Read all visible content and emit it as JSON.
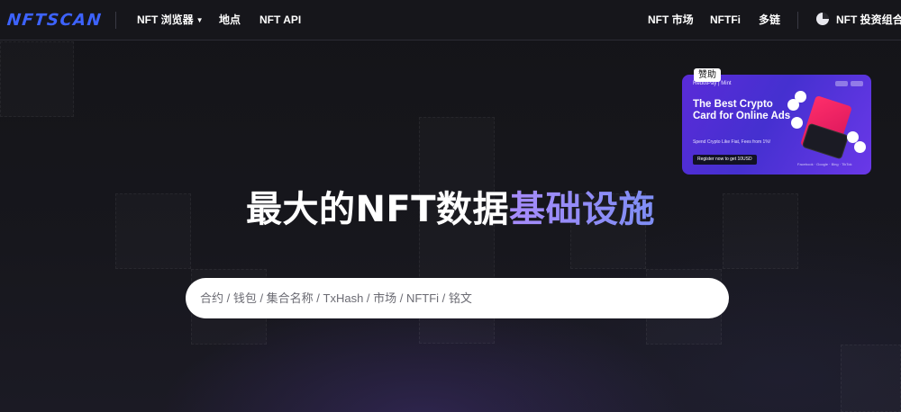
{
  "brand": {
    "logo_text": "NFTSCAN",
    "accent": "#3d63ff"
  },
  "nav": {
    "left": [
      {
        "label": "NFT 浏览器",
        "icon": "chevron-down-icon"
      },
      {
        "label": "地点"
      },
      {
        "label": "NFT API"
      }
    ],
    "right": [
      {
        "label": "NFT 市场"
      },
      {
        "label": "NFTFi"
      },
      {
        "label": "多链"
      }
    ],
    "portfolio": {
      "label": "NFT 投资组合",
      "icon": "pie-chart-icon"
    }
  },
  "ad": {
    "sponsor_label": "赞助",
    "brands": "RedotPay  |  Mint",
    "title": "The Best Crypto Card for Online Ads",
    "subtitle": "Spend Crypto Like Fiat, Fees from 1%!",
    "cta": "Register now to get 10USD",
    "footer": "Facebook · Google · Bing · TikTok"
  },
  "hero": {
    "headline_white": "最大的NFT数据",
    "headline_accent": "基础设施",
    "accent_color": "#a78bfa"
  },
  "search": {
    "placeholder": "合约 / 钱包 / 集合名称 / TxHash / 市场 / NFTFi / 铭文",
    "value": ""
  }
}
